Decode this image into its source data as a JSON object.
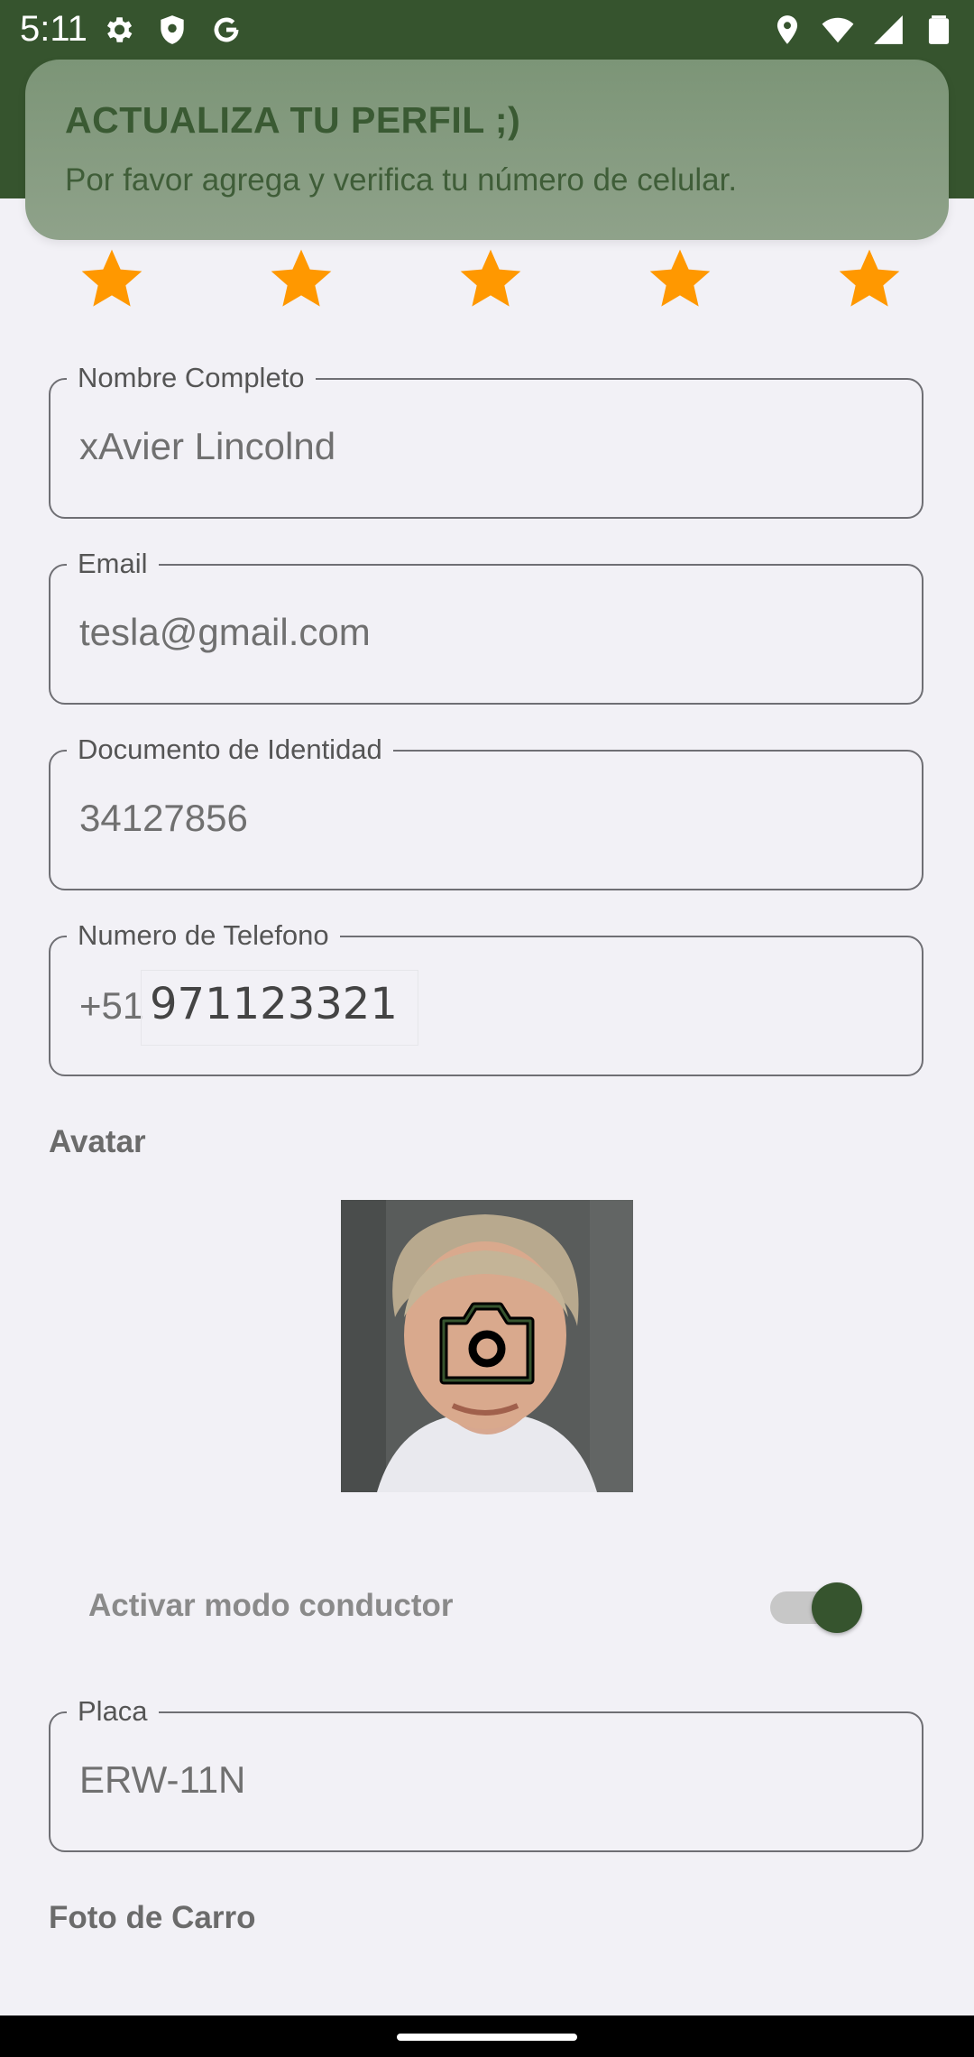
{
  "status_bar": {
    "time": "5:11",
    "left_icons": [
      "gear-icon",
      "shield-icon",
      "google-icon"
    ],
    "right_icons": [
      "location-icon",
      "wifi-icon",
      "signal-icon",
      "battery-icon"
    ]
  },
  "banner": {
    "title": "ACTUALIZA TU PERFIL ;)",
    "message": "Por favor agrega y verifica tu número de celular."
  },
  "rating": {
    "value": 5,
    "max": 5,
    "color": "#ff9800"
  },
  "form": {
    "full_name": {
      "label": "Nombre Completo",
      "value": "xAvier Lincolnd"
    },
    "email": {
      "label": "Email",
      "value": "tesla@gmail.com"
    },
    "document": {
      "label": "Documento de Identidad",
      "value": "34127856"
    },
    "phone": {
      "label": "Numero de Telefono",
      "prefix": "+51",
      "value": "971123321"
    },
    "avatar_label": "Avatar",
    "driver_mode": {
      "label": "Activar modo conductor",
      "enabled": true
    },
    "plate": {
      "label": "Placa",
      "value": "ERW-11N"
    },
    "car_photo_label": "Foto de Carro"
  },
  "colors": {
    "primary": "#36542e",
    "banner": "#869c80",
    "background": "#f2f1f6"
  }
}
